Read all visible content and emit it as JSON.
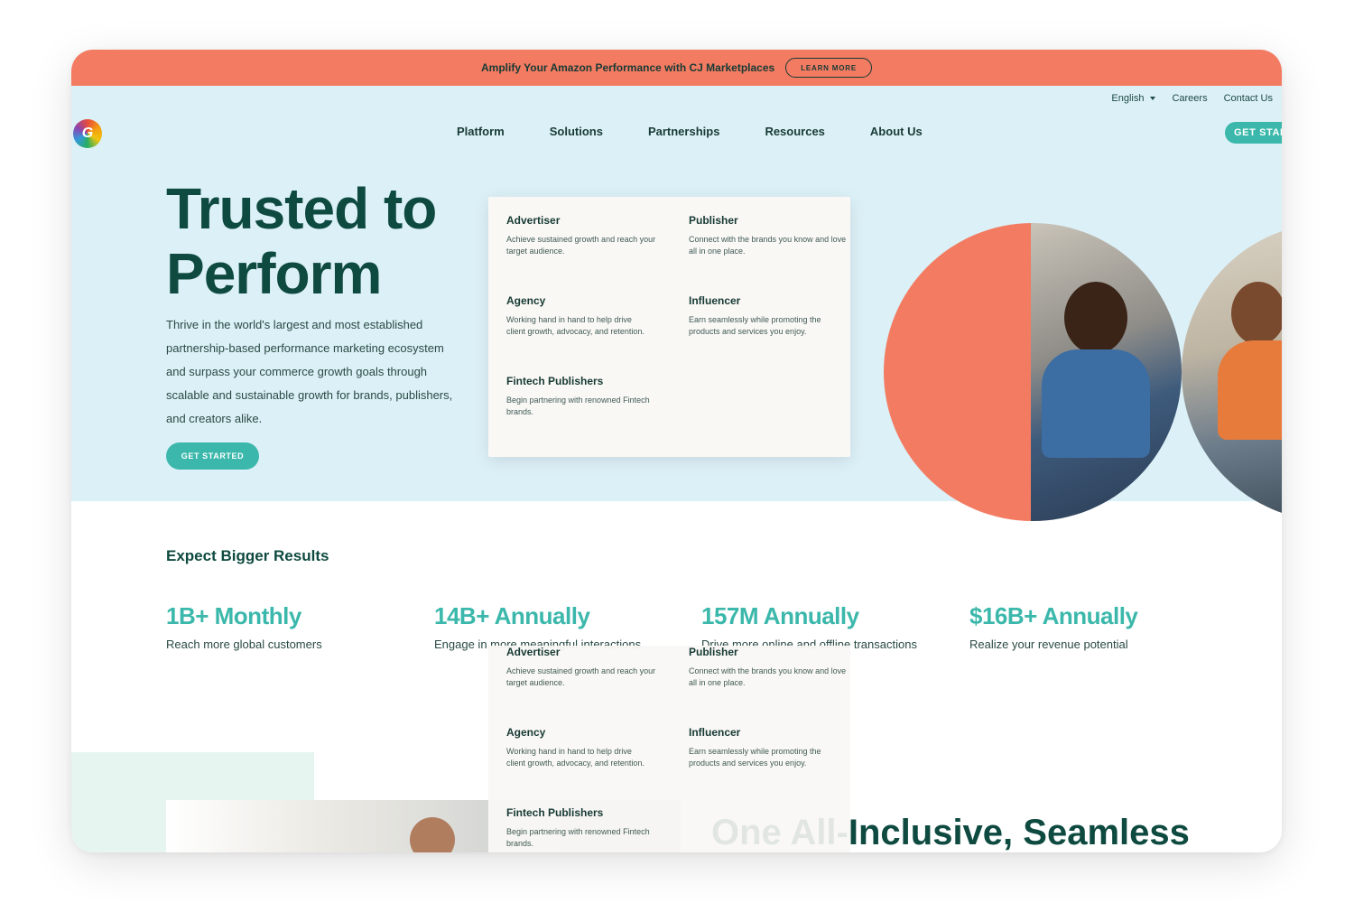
{
  "promo": {
    "text": "Amplify Your Amazon Performance with CJ Marketplaces",
    "button": "LEARN MORE"
  },
  "utility": {
    "language": "English",
    "careers": "Careers",
    "contact": "Contact Us"
  },
  "logo": {
    "letter": "G"
  },
  "nav": [
    "Platform",
    "Solutions",
    "Partnerships",
    "Resources",
    "About Us"
  ],
  "header_cta": "GET STARTED",
  "hero": {
    "title_line1": "Trusted to",
    "title_line2": "Perform",
    "description": "Thrive in the world's largest and most established partnership-based performance marketing ecosystem and surpass your commerce growth goals through scalable and sustainable growth for brands, publishers, and creators alike.",
    "button": "GET STARTED"
  },
  "dropdown": [
    {
      "title": "Advertiser",
      "desc": "Achieve sustained growth and reach your target audience."
    },
    {
      "title": "Publisher",
      "desc": "Connect with the brands you know and love all in one place."
    },
    {
      "title": "Agency",
      "desc": "Working hand in hand to help drive client growth, advocacy, and retention."
    },
    {
      "title": "Influencer",
      "desc": "Earn seamlessly while promoting the products and services you enjoy."
    },
    {
      "title": "Fintech Publishers",
      "desc": "Begin partnering with renowned Fintech brands."
    }
  ],
  "results": {
    "title": "Expect Bigger Results",
    "stats": [
      {
        "value": "1B+ Monthly",
        "label": "Reach more global customers"
      },
      {
        "value": "14B+ Annually",
        "label": "Engage in more meaningful interactions"
      },
      {
        "value": "157M Annually",
        "label": "Drive more online and offline transactions"
      },
      {
        "value": "$16B+ Annually",
        "label": "Realize your revenue potential"
      }
    ]
  },
  "bottom": {
    "faded": "One All-",
    "headline": "Inclusive, Seamless"
  }
}
